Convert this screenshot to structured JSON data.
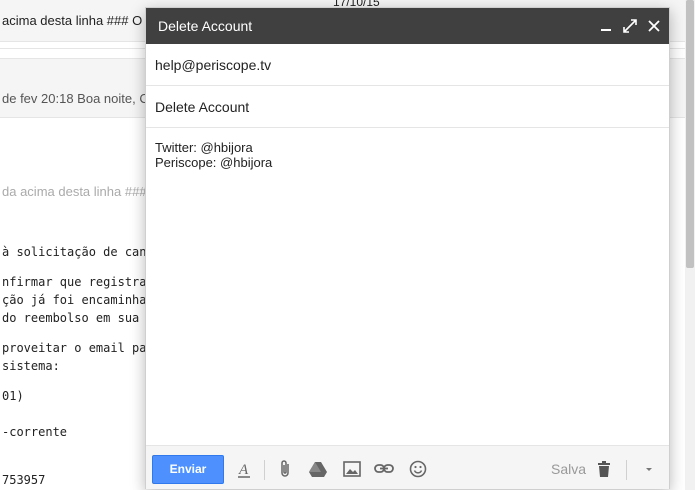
{
  "background": {
    "row1_text": "acima desta linha ### O",
    "row1_date": "17/10/15",
    "row2_text": "de fev 20:18 Boa noite, C",
    "quote_line": "da acima desta linha ###",
    "lines": [
      "à solicitação de cancelan",
      "nfirmar que registramos",
      "ção já foi encaminhada p",
      "do reembolso em sua co",
      "proveitar o email para cor",
      "sistema:",
      "01)",
      "-corrente",
      "753957"
    ]
  },
  "compose": {
    "title": "Delete Account",
    "to": "help@periscope.tv",
    "subject": "Delete Account",
    "body_lines": [
      "Twitter: @hbijora",
      "Periscope: @hbijora"
    ],
    "send_label": "Enviar",
    "saved_label": "Salva"
  },
  "colors": {
    "titlebar": "#404040",
    "send_button": "#4d90fe",
    "toolbar_bg": "#f5f5f5"
  }
}
